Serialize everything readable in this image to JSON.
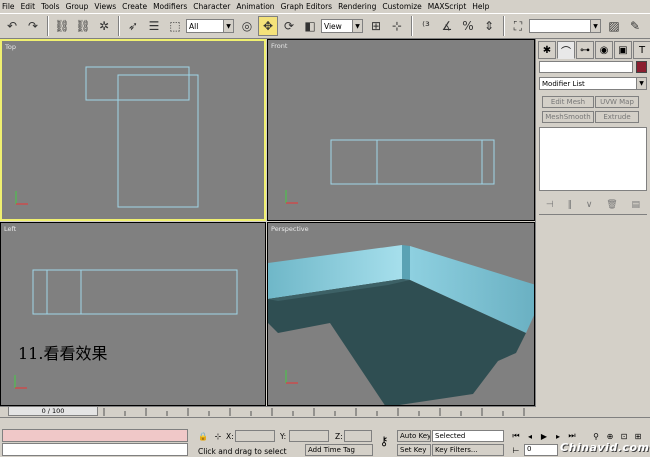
{
  "menu": [
    "File",
    "Edit",
    "Tools",
    "Group",
    "Views",
    "Create",
    "Modifiers",
    "Character",
    "Animation",
    "Graph Editors",
    "Rendering",
    "Customize",
    "MAXScript",
    "Help"
  ],
  "toolbar": {
    "selection_filter": "All",
    "coord_system": "View"
  },
  "viewports": {
    "top": "Top",
    "front": "Front",
    "left": "Left",
    "perspective": "Perspective"
  },
  "caption": "11.看看效果",
  "panel": {
    "modifier_list": "Modifier List",
    "buttons": [
      "Edit Mesh",
      "UVW Map",
      "MeshSmooth",
      "Extrude"
    ]
  },
  "timeline": {
    "frame": "0 / 100"
  },
  "status": {
    "x_label": "X:",
    "y_label": "Y:",
    "z_label": "Z:",
    "auto_key": "Auto Key",
    "set_key": "Set Key",
    "selected": "Selected",
    "key_filters": "Key Filters...",
    "prompt": "Click and drag to select",
    "add_time_tag": "Add Time Tag",
    "frame_value": "0"
  },
  "watermark": "Chinavid.com",
  "colors": {
    "viewport_bg": "#808080",
    "wireframe": "#9fd6e8",
    "active_border": "#f0f070",
    "object_color": "#8b1f30"
  }
}
